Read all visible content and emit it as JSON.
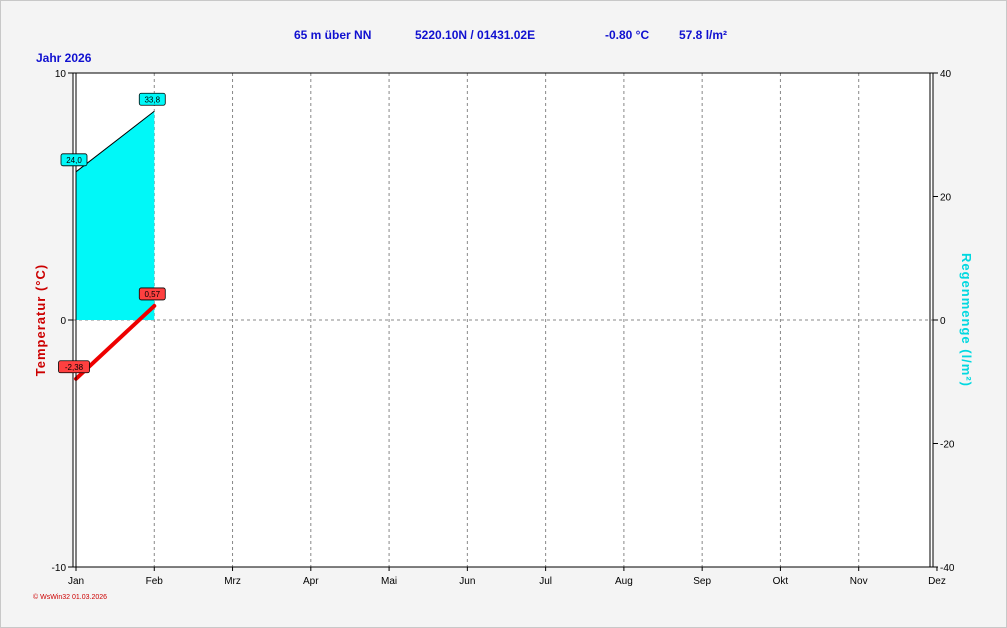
{
  "header": {
    "elevation": "65 m über NN",
    "coordinates": "5220.10N / 01431.02E",
    "temperature": "-0.80 °C",
    "precipitation": "57.8 l/m²"
  },
  "year_label": "Jahr  2026",
  "credit": "© WsWin32  01.03.2026",
  "colors": {
    "temperature": "#ee0000",
    "rain_fill": "#00f8f8",
    "header_text": "#1010d0",
    "rain_axis_text": "#00d8e0"
  },
  "chart_data": {
    "type": "area",
    "categories": [
      "Jan",
      "Feb",
      "Mrz",
      "Apr",
      "Mai",
      "Jun",
      "Jul",
      "Aug",
      "Sep",
      "Okt",
      "Nov",
      "Dez"
    ],
    "y_left": {
      "label": "Temperatur  (°C)",
      "ylim": [
        -10,
        10
      ],
      "ticks": [
        "10",
        "0",
        "-10"
      ]
    },
    "y_right": {
      "label": "Regenmenge  (l/m²)",
      "ylim": [
        -40,
        40
      ],
      "ticks": [
        "40",
        "20",
        "0",
        "-20",
        "-40"
      ]
    },
    "grid": true,
    "series": [
      {
        "axis": "right",
        "type": "area",
        "x": [
          0,
          1
        ],
        "values": [
          24.0,
          33.8
        ],
        "labels": [
          "24,0",
          "33,8"
        ]
      },
      {
        "axis": "left",
        "type": "line",
        "x": [
          0,
          1
        ],
        "values": [
          -2.38,
          0.57
        ],
        "labels": [
          "-2,38",
          "0,57"
        ]
      }
    ]
  }
}
